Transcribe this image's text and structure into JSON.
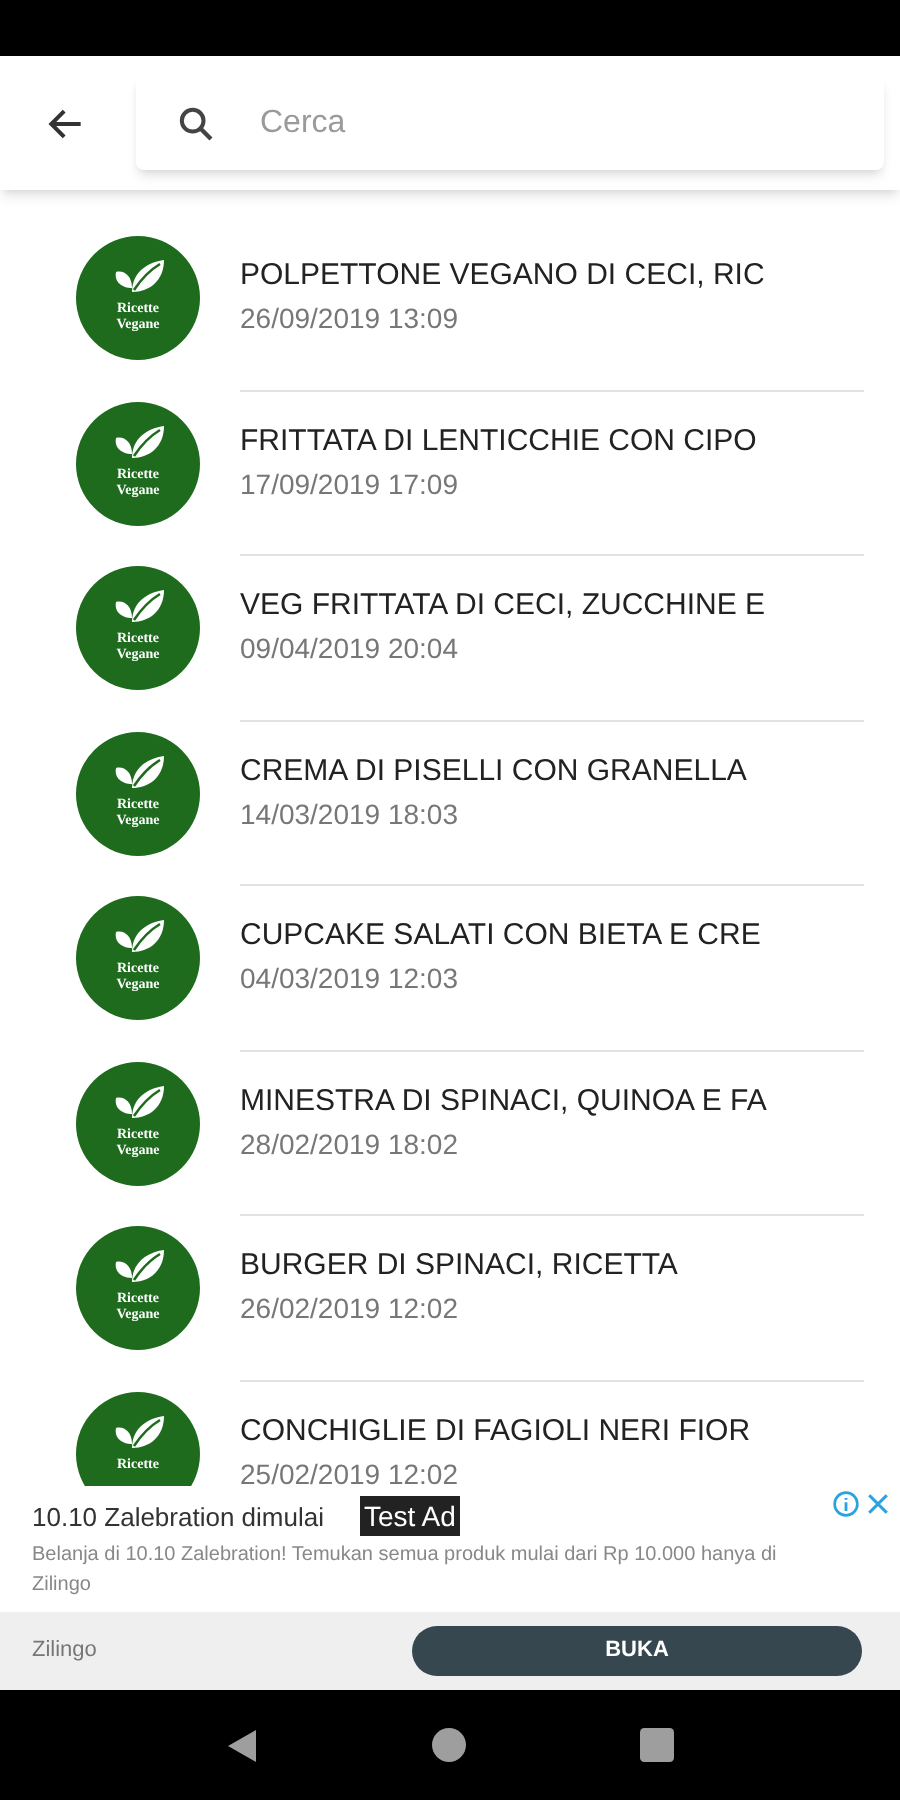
{
  "search": {
    "placeholder": "Cerca"
  },
  "recipes": [
    {
      "title": "POLPETTONE VEGANO DI CECI, RIC",
      "date": "26/09/2019 13:09",
      "logo_text": [
        "Ricette",
        "Vegane"
      ]
    },
    {
      "title": "FRITTATA DI LENTICCHIE CON CIPO",
      "date": "17/09/2019 17:09",
      "logo_text": [
        "Ricette",
        "Vegane"
      ]
    },
    {
      "title": "VEG FRITTATA DI CECI, ZUCCHINE E",
      "date": "09/04/2019 20:04",
      "logo_text": [
        "Ricette",
        "Vegane"
      ]
    },
    {
      "title": "CREMA DI PISELLI CON GRANELLA",
      "date": "14/03/2019 18:03",
      "logo_text": [
        "Ricette",
        "Vegane"
      ]
    },
    {
      "title": "CUPCAKE SALATI CON BIETA E CRE",
      "date": "04/03/2019 12:03",
      "logo_text": [
        "Ricette",
        "Vegane"
      ]
    },
    {
      "title": "MINESTRA DI SPINACI, QUINOA E FA",
      "date": "28/02/2019 18:02",
      "logo_text": [
        "Ricette",
        "Vegane"
      ]
    },
    {
      "title": "BURGER DI SPINACI, RICETTA",
      "date": "26/02/2019 12:02",
      "logo_text": [
        "Ricette",
        "Vegane"
      ]
    },
    {
      "title": "CONCHIGLIE DI FAGIOLI NERI FIOR",
      "date": "25/02/2019 12:02",
      "logo_text": [
        "Ricette"
      ]
    }
  ],
  "ad": {
    "headline": "10.10 Zalebration dimulai",
    "badge": "Test Ad",
    "body": "Belanja di 10.10 Zalebration! Temukan semua produk mulai dari Rp 10.000 hanya di Zilingo",
    "advertiser": "Zilingo",
    "button": "BUKA"
  }
}
